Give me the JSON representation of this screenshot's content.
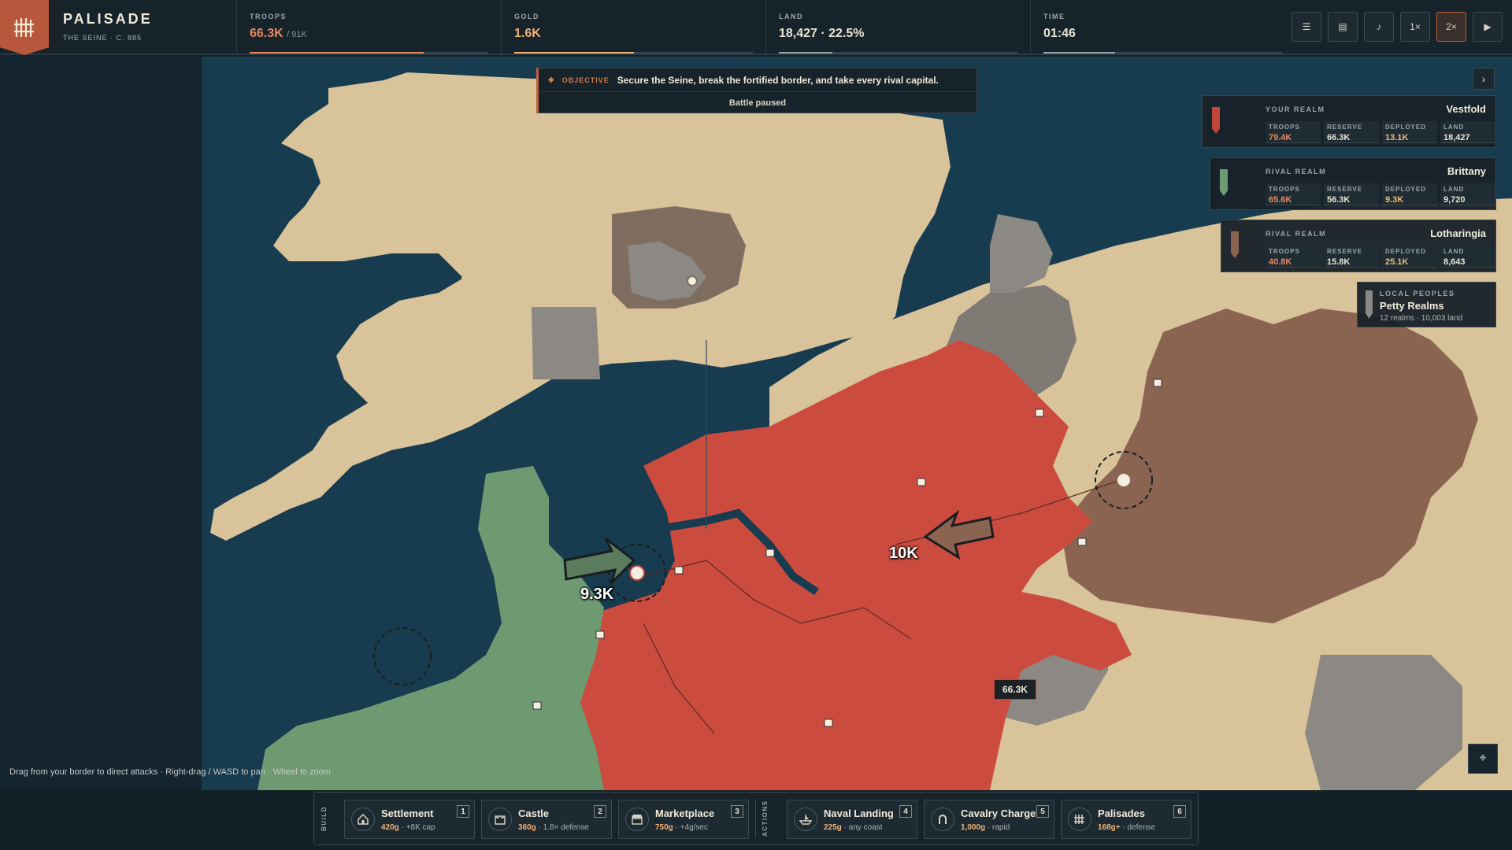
{
  "app": {
    "title": "PALISADE",
    "subtitle": "THE SEINE · C. 885"
  },
  "stats": {
    "troops": {
      "label": "TROOPS",
      "value": "66.3K",
      "cap": "/ 91K",
      "progress": 0.73,
      "color": "#e98962"
    },
    "gold": {
      "label": "GOLD",
      "value": "1.6K",
      "progress": 0.5,
      "color": "#f0b27a"
    },
    "land": {
      "label": "LAND",
      "value": "18,427 · 22.5%",
      "progress": 0.225,
      "color": "#9aa6aa"
    },
    "time": {
      "label": "TIME",
      "value": "01:46",
      "progress": 0.3,
      "color": "#9aa6aa"
    }
  },
  "controls": {
    "menu_icon": "menu-icon",
    "stats_icon": "stats-icon",
    "music_icon": "music-icon",
    "speed1_label": "1×",
    "speed2_label": "2×",
    "play_icon": "play-icon"
  },
  "objective": {
    "tag": "OBJECTIVE",
    "text": "Secure the Seine, break the fortified border, and take every rival capital.",
    "status": "Battle paused"
  },
  "realms": [
    {
      "kind": "YOUR REALM",
      "name": "Vestfold",
      "color": "#c1463a",
      "stats": [
        {
          "label": "TROOPS",
          "value": "79.4K"
        },
        {
          "label": "RESERVE",
          "value": "66.3K"
        },
        {
          "label": "DEPLOYED",
          "value": "13.1K"
        },
        {
          "label": "LAND",
          "value": "18,427"
        }
      ]
    },
    {
      "kind": "RIVAL REALM",
      "name": "Brittany",
      "color": "#6e9a72",
      "stats": [
        {
          "label": "TROOPS",
          "value": "65.6K"
        },
        {
          "label": "RESERVE",
          "value": "56.3K"
        },
        {
          "label": "DEPLOYED",
          "value": "9.3K"
        },
        {
          "label": "LAND",
          "value": "9,720"
        }
      ]
    },
    {
      "kind": "RIVAL REALM",
      "name": "Lotharingia",
      "color": "#8a6450",
      "stats": [
        {
          "label": "TROOPS",
          "value": "40.8K"
        },
        {
          "label": "RESERVE",
          "value": "15.8K"
        },
        {
          "label": "DEPLOYED",
          "value": "25.1K"
        },
        {
          "label": "LAND",
          "value": "8,643"
        }
      ]
    }
  ],
  "local_peoples": {
    "kind": "LOCAL PEOPLES",
    "name": "Petty Realms",
    "detail": "12 realms · 10,003 land"
  },
  "map": {
    "army_left": "9.3K",
    "army_right": "10K",
    "troop_box": "66.3K",
    "hint": "Drag from your border to direct attacks · Right-drag / WASD to pan · Wheel to zoom"
  },
  "bottombar": {
    "build_label": "BUILD",
    "actions_label": "ACTIONS",
    "build": [
      {
        "name": "Settlement",
        "cost": "420g",
        "desc": "· +8K cap",
        "key": "1",
        "icon": "house-icon"
      },
      {
        "name": "Castle",
        "cost": "360g",
        "desc": "· 1.8× defense",
        "key": "2",
        "icon": "castle-icon"
      },
      {
        "name": "Marketplace",
        "cost": "750g",
        "desc": "· +4g/sec",
        "key": "3",
        "icon": "market-icon"
      }
    ],
    "actions": [
      {
        "name": "Naval Landing",
        "cost": "225g",
        "desc": "· any coast",
        "key": "4",
        "icon": "ship-icon"
      },
      {
        "name": "Cavalry Charge",
        "cost": "1,000g",
        "desc": "· rapid",
        "key": "5",
        "icon": "horseshoe-icon"
      },
      {
        "name": "Palisades",
        "cost": "168g+",
        "desc": "· defense",
        "key": "6",
        "icon": "palisade-icon"
      }
    ]
  }
}
